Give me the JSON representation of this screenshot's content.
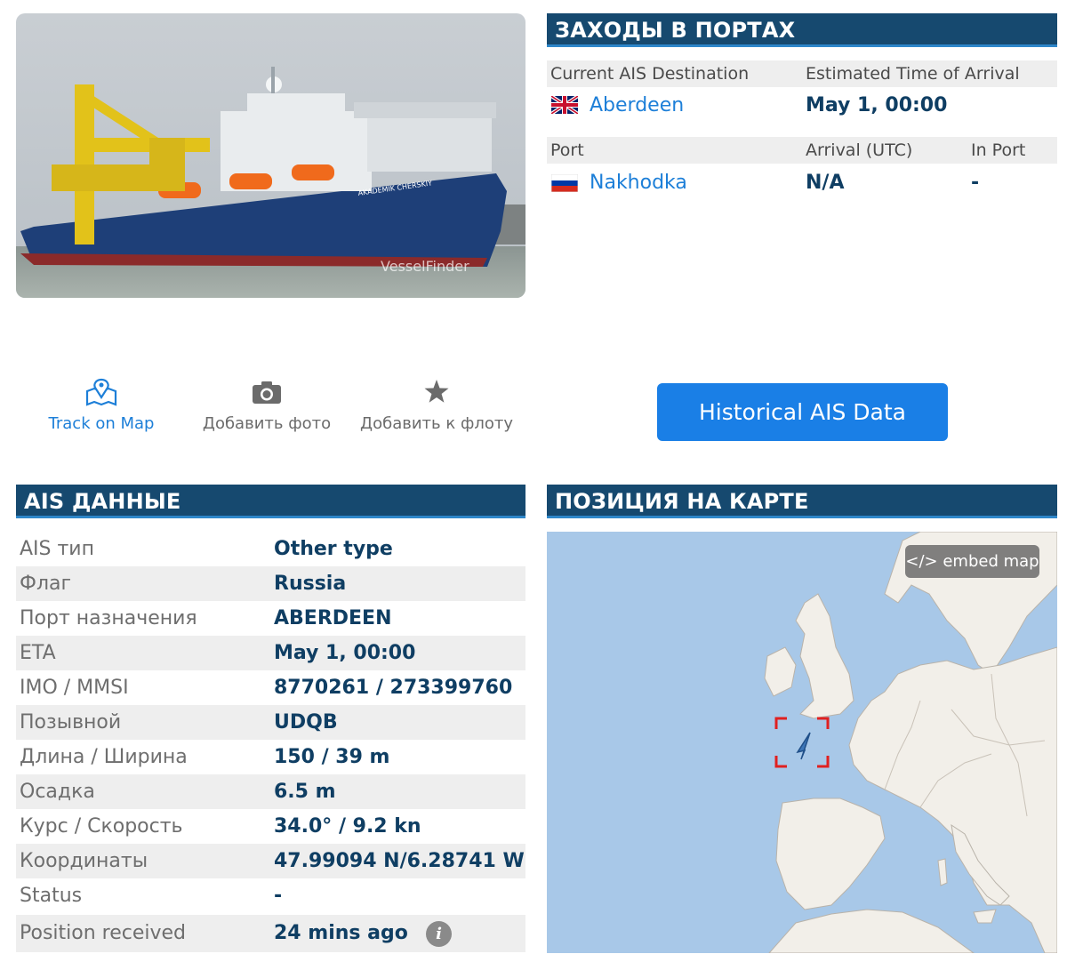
{
  "photo": {
    "ship_name_text": "AKADEMIK CHERSKIY",
    "watermark": "VesselFinder"
  },
  "port_calls": {
    "header": "ЗАХОДЫ В ПОРТАХ",
    "destination_label": "Current AIS Destination",
    "eta_label": "Estimated Time of Arrival",
    "destination_value": "Aberdeen",
    "destination_flag": "gb-flag",
    "eta_value": "May 1, 00:00",
    "port_label": "Port",
    "arrival_label": "Arrival (UTC)",
    "in_port_label": "In Port",
    "port_value": "Nakhodka",
    "port_flag": "ru-flag",
    "arrival_value": "N/A",
    "in_port_value": "-"
  },
  "actions": {
    "track": "Track on Map",
    "add_photo": "Добавить фото",
    "add_fleet": "Добавить к флоту",
    "historical": "Historical AIS Data"
  },
  "ais": {
    "header": "AIS ДАННЫЕ",
    "rows": [
      {
        "key": "AIS тип",
        "value": "Other type"
      },
      {
        "key": "Флаг",
        "value": "Russia"
      },
      {
        "key": "Порт назначения",
        "value": "ABERDEEN"
      },
      {
        "key": "ETA",
        "value": "May 1, 00:00"
      },
      {
        "key": "IMO / MMSI",
        "value": "8770261 / 273399760"
      },
      {
        "key": "Позывной",
        "value": "UDQB"
      },
      {
        "key": "Длина / Ширина",
        "value": "150 / 39 m"
      },
      {
        "key": "Осадка",
        "value": "6.5 m"
      },
      {
        "key": "Курс / Скорость",
        "value": "34.0° / 9.2 kn"
      },
      {
        "key": "Координаты",
        "value": "47.99094 N/6.28741 W"
      },
      {
        "key": "Status",
        "value": "-"
      },
      {
        "key": "Position received",
        "value": "24 mins ago"
      }
    ]
  },
  "map": {
    "header": "ПОЗИЦИЯ НА КАРТЕ",
    "embed_label": "</> embed map",
    "sea_color": "#a8c8e8",
    "land_color": "#f2efe9",
    "marker_color": "#e02020"
  },
  "colors": {
    "header_bg": "#16496f",
    "header_border": "#2d86c9",
    "link": "#1d7fd8",
    "value": "#0f3e63",
    "button": "#1a7fe6"
  }
}
